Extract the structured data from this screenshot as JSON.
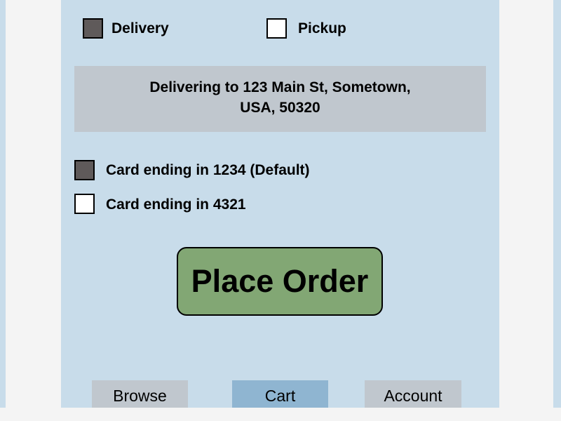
{
  "fulfillment": {
    "delivery": {
      "label": "Delivery",
      "checked": true
    },
    "pickup": {
      "label": "Pickup",
      "checked": false
    }
  },
  "address": {
    "line1": "Delivering to 123 Main St, Sometown,",
    "line2": "USA, 50320"
  },
  "payment": {
    "cards": [
      {
        "label": "Card ending in 1234 (Default)",
        "checked": true
      },
      {
        "label": "Card ending in 4321",
        "checked": false
      }
    ]
  },
  "actions": {
    "place_order": "Place Order"
  },
  "nav": {
    "items": [
      {
        "label": "Browse",
        "active": false
      },
      {
        "label": "Cart",
        "active": true
      },
      {
        "label": "Account",
        "active": false
      }
    ]
  },
  "colors": {
    "page_background": "#f4f4f4",
    "panel_background": "#c8dcea",
    "address_background": "#c0c7ce",
    "checkbox_checked": "#5f5a5a",
    "place_order_button": "#82a774",
    "nav_inactive": "#c0c7ce",
    "nav_active": "#8fb5d1"
  }
}
